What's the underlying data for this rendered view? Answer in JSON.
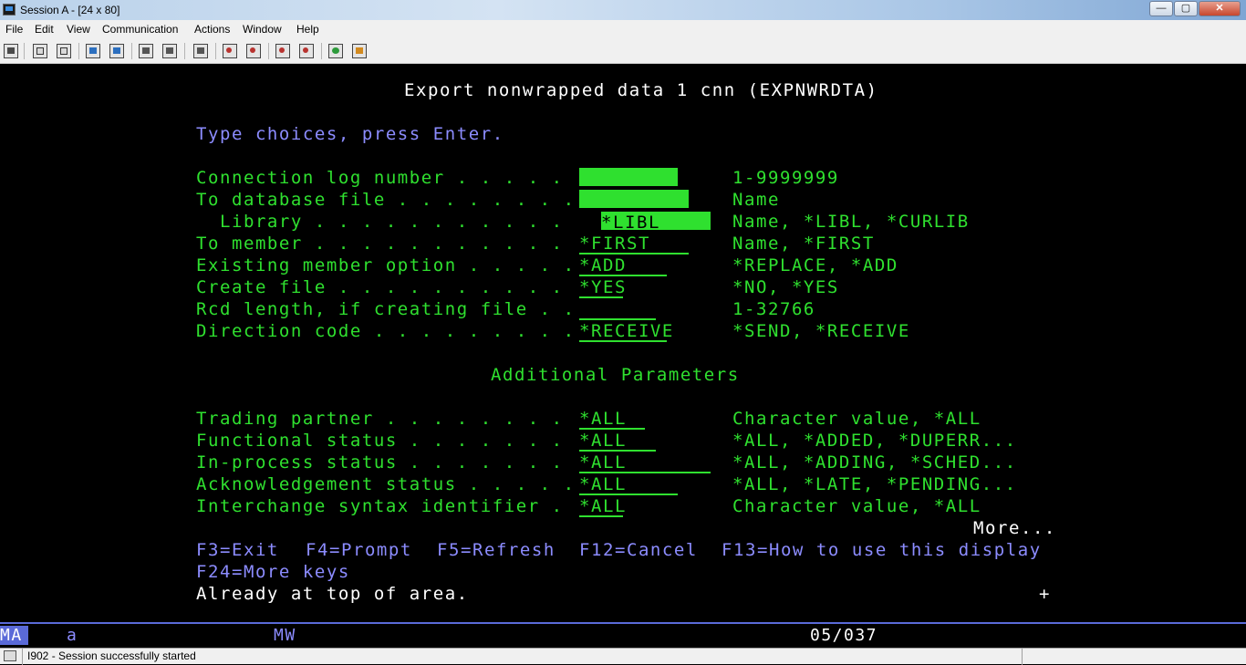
{
  "window": {
    "title": "Session A - [24 x 80]",
    "controls": {
      "minimize": "—",
      "maximize": "▢",
      "close": "✕"
    }
  },
  "menu": [
    "File",
    "Edit",
    "View",
    "Communication",
    "Actions",
    "Window",
    "Help"
  ],
  "toolbar": {
    "icons": [
      "print-screen-icon",
      "copy-icon",
      "paste-icon",
      "send-file-icon",
      "receive-file-icon",
      "display-icon",
      "keypad-icon",
      "macro-icon",
      "record-macro-icon",
      "play-macro-icon",
      "stop-macro-icon",
      "color-icon",
      "customize-icon"
    ]
  },
  "screen": {
    "title": "Export nonwrapped data 1 cnn (EXPNWRDTA)",
    "instruction": "Type choices, press Enter.",
    "fields": [
      {
        "label": "Connection log number . . . . .",
        "value": "",
        "hint": "1-9999999"
      },
      {
        "label": "To database file . . . . . . . .",
        "value": "",
        "hint": "Name"
      },
      {
        "label": "  Library . . . . . . . . . . .",
        "value": "*LIBL",
        "hint": "Name, *LIBL, *CURLIB"
      },
      {
        "label": "To member . . . . . . . . . . .",
        "value": "*FIRST",
        "hint": "Name, *FIRST"
      },
      {
        "label": "Existing member option . . . . .",
        "value": "*ADD",
        "hint": "*REPLACE, *ADD"
      },
      {
        "label": "Create file . . . . . . . . . .",
        "value": "*YES",
        "hint": "*NO, *YES"
      },
      {
        "label": "Rcd length, if creating file . .",
        "value": "",
        "hint": "1-32766"
      },
      {
        "label": "Direction code . . . . . . . . .",
        "value": "*RECEIVE",
        "hint": "*SEND, *RECEIVE"
      }
    ],
    "section": "Additional Parameters",
    "additional_fields": [
      {
        "label": "Trading partner . . . . . . . .",
        "value": "*ALL",
        "hint": "Character value, *ALL"
      },
      {
        "label": "Functional status . . . . . . .",
        "value": "*ALL",
        "hint": "*ALL, *ADDED, *DUPERR..."
      },
      {
        "label": "In-process status . . . . . . .",
        "value": "*ALL",
        "hint": "*ALL, *ADDING, *SCHED..."
      },
      {
        "label": "Acknowledgement status . . . . .",
        "value": "*ALL",
        "hint": "*ALL, *LATE, *PENDING..."
      },
      {
        "label": "Interchange syntax identifier .",
        "value": "*ALL",
        "hint": "Character value, *ALL"
      }
    ],
    "more": "More...",
    "function_keys": [
      "F3=Exit",
      "F4=Prompt",
      "F5=Refresh",
      "F12=Cancel",
      "F13=How to use this display",
      "F24=More keys"
    ],
    "message": "Already at top of area.",
    "plus": "+"
  },
  "oia": {
    "mode": "MA",
    "shift": "a",
    "mw": "MW",
    "cursor": "05/037"
  },
  "status": {
    "message": "I902 - Session successfully started"
  },
  "colors": {
    "field_green": "#2fe02f",
    "text_blue": "#8c8cff",
    "oia_bar": "#5a6ad8"
  }
}
